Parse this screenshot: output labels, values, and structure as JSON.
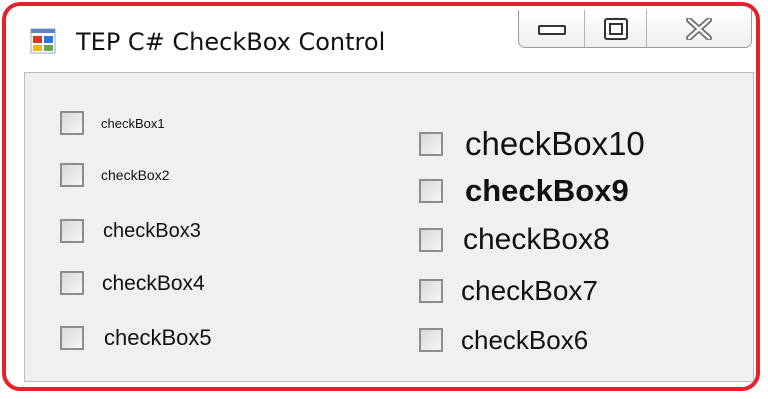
{
  "window": {
    "title": "TEP C# CheckBox Control",
    "app_icon": "windows-forms-app-icon",
    "border_color": "#e4222b",
    "client_background": "#f0f0f0",
    "caption_buttons": {
      "minimize_icon": "minimize-icon",
      "maximize_icon": "maximize-icon",
      "close_icon": "close-icon"
    }
  },
  "checkboxes": [
    {
      "label": "checkBox1",
      "checked": false
    },
    {
      "label": "checkBox2",
      "checked": false
    },
    {
      "label": "checkBox3",
      "checked": false
    },
    {
      "label": "checkBox4",
      "checked": false
    },
    {
      "label": "checkBox5",
      "checked": false
    },
    {
      "label": "checkBox10",
      "checked": false
    },
    {
      "label": "checkBox9",
      "checked": false
    },
    {
      "label": "checkBox8",
      "checked": false
    },
    {
      "label": "checkBox7",
      "checked": false
    },
    {
      "label": "checkBox6",
      "checked": false
    }
  ]
}
